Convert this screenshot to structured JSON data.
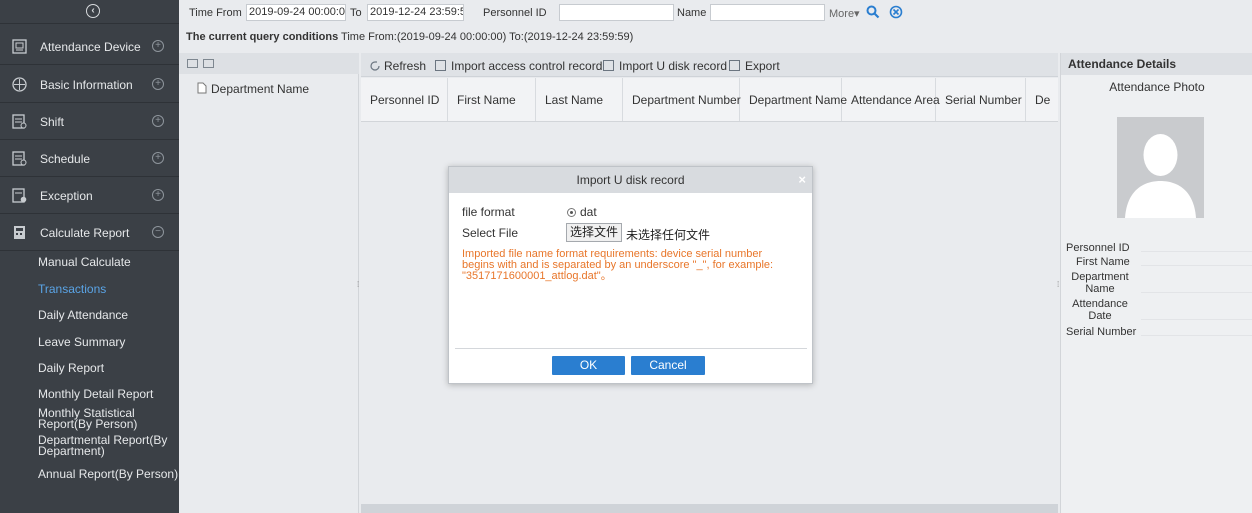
{
  "sidebar": {
    "menus": [
      {
        "label": "Attendance Device",
        "icon": "attendance-device-icon",
        "toggle": "⊕"
      },
      {
        "label": "Basic Information",
        "icon": "basic-information-icon",
        "toggle": "⊕"
      },
      {
        "label": "Shift",
        "icon": "shift-icon",
        "toggle": "⊕"
      },
      {
        "label": "Schedule",
        "icon": "schedule-icon",
        "toggle": "⊕"
      },
      {
        "label": "Exception",
        "icon": "exception-icon",
        "toggle": "⊕"
      },
      {
        "label": "Calculate Report",
        "icon": "calculate-report-icon",
        "toggle": "⊖"
      }
    ],
    "submenu": [
      "Manual Calculate",
      "Transactions",
      "Daily Attendance",
      "Leave Summary",
      "Daily Report",
      "Monthly Detail Report",
      "Monthly Statistical Report(By Person)",
      "Departmental Report(By Department)",
      "Annual Report(By Person)"
    ],
    "active_submenu": "Transactions"
  },
  "filter": {
    "time_from_label": "Time From",
    "time_from_value": "2019-09-24 00:00:0",
    "to_label": "To",
    "to_value": "2019-12-24 23:59:5",
    "personnel_id_label": "Personnel ID",
    "name_label": "Name",
    "more_label": "More▾"
  },
  "query_conditions": {
    "label": "The current query conditions",
    "value": "Time From:(2019-09-24 00:00:00)  To:(2019-12-24 23:59:59)"
  },
  "department": {
    "tree_root": "Department Name"
  },
  "toolbar": {
    "refresh": "Refresh",
    "import_access": "Import access control record",
    "import_udisk": "Import U disk record",
    "export": "Export"
  },
  "grid": {
    "columns": [
      "Personnel ID",
      "First Name",
      "Last Name",
      "Department Number",
      "Department Name",
      "Attendance Area",
      "Serial Number",
      "De"
    ]
  },
  "details": {
    "title": "Attendance Details",
    "photo_label": "Attendance Photo",
    "fields": [
      "Personnel ID",
      "First Name",
      "Department Name",
      "Attendance Date",
      "Serial Number"
    ]
  },
  "dialog": {
    "title": "Import U disk record",
    "close": "×",
    "file_format_label": "file format",
    "file_format_value": "dat",
    "select_file_label": "Select File",
    "choose_file_button": "选择文件",
    "no_file_text": "未选择任何文件",
    "note": "Imported file name format requirements: device serial number begins with and is separated by an underscore \"_\", for example: \"3517171600001_attlog.dat\"。",
    "ok": "OK",
    "cancel": "Cancel"
  },
  "colors": {
    "sidebar_bg": "#3b4046",
    "active_link": "#5aa4e6",
    "primary_button": "#2a7ed0",
    "note_text": "#e8762a",
    "search_icon": "#2a7ed0"
  }
}
